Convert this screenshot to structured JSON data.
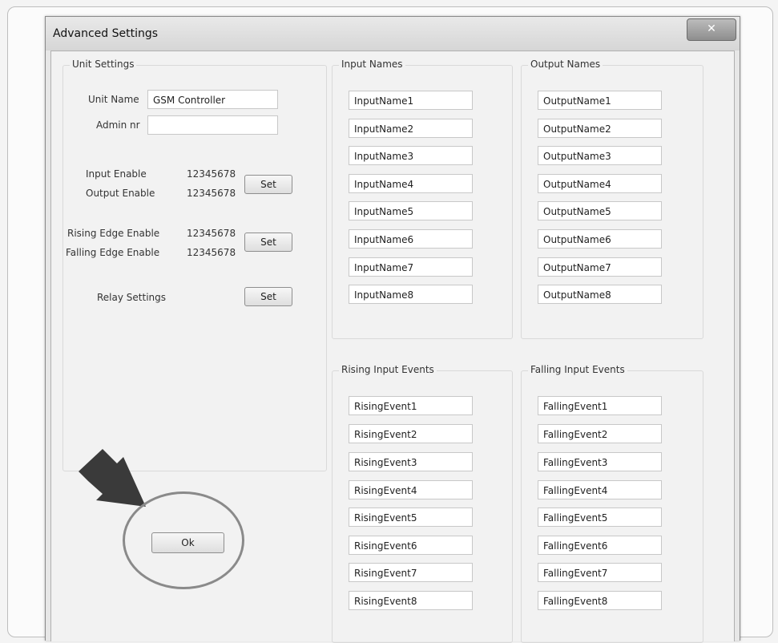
{
  "window": {
    "title": "Advanced Settings",
    "close_icon": "close-icon",
    "close_glyph": "✕"
  },
  "unit_settings": {
    "title": "Unit Settings",
    "unit_name_label": "Unit Name",
    "unit_name_value": "GSM Controller",
    "admin_label": "Admin nr",
    "admin_value": "",
    "input_enable_label": "Input Enable",
    "input_enable_value": "12345678",
    "output_enable_label": "Output Enable",
    "output_enable_value": "12345678",
    "set_label": "Set",
    "rising_label": "Rising Edge Enable",
    "rising_value": "12345678",
    "falling_label": "Falling Edge Enable",
    "falling_value": "12345678",
    "relay_label": "Relay Settings"
  },
  "input_names": {
    "title": "Input Names",
    "items": [
      "InputName1",
      "InputName2",
      "InputName3",
      "InputName4",
      "InputName5",
      "InputName6",
      "InputName7",
      "InputName8"
    ]
  },
  "output_names": {
    "title": "Output Names",
    "items": [
      "OutputName1",
      "OutputName2",
      "OutputName3",
      "OutputName4",
      "OutputName5",
      "OutputName6",
      "OutputName7",
      "OutputName8"
    ]
  },
  "rising_events": {
    "title": "Rising Input Events",
    "items": [
      "RisingEvent1",
      "RisingEvent2",
      "RisingEvent3",
      "RisingEvent4",
      "RisingEvent5",
      "RisingEvent6",
      "RisingEvent7",
      "RisingEvent8"
    ]
  },
  "falling_events": {
    "title": "Falling Input Events",
    "items": [
      "FallingEvent1",
      "FallingEvent2",
      "FallingEvent3",
      "FallingEvent4",
      "FallingEvent5",
      "FallingEvent6",
      "FallingEvent7",
      "FallingEvent8"
    ]
  },
  "ok_label": "Ok",
  "annotation": {
    "arrow_icon": "arrow-icon",
    "ring": "highlight-circle",
    "color": "#3a3a3a"
  }
}
